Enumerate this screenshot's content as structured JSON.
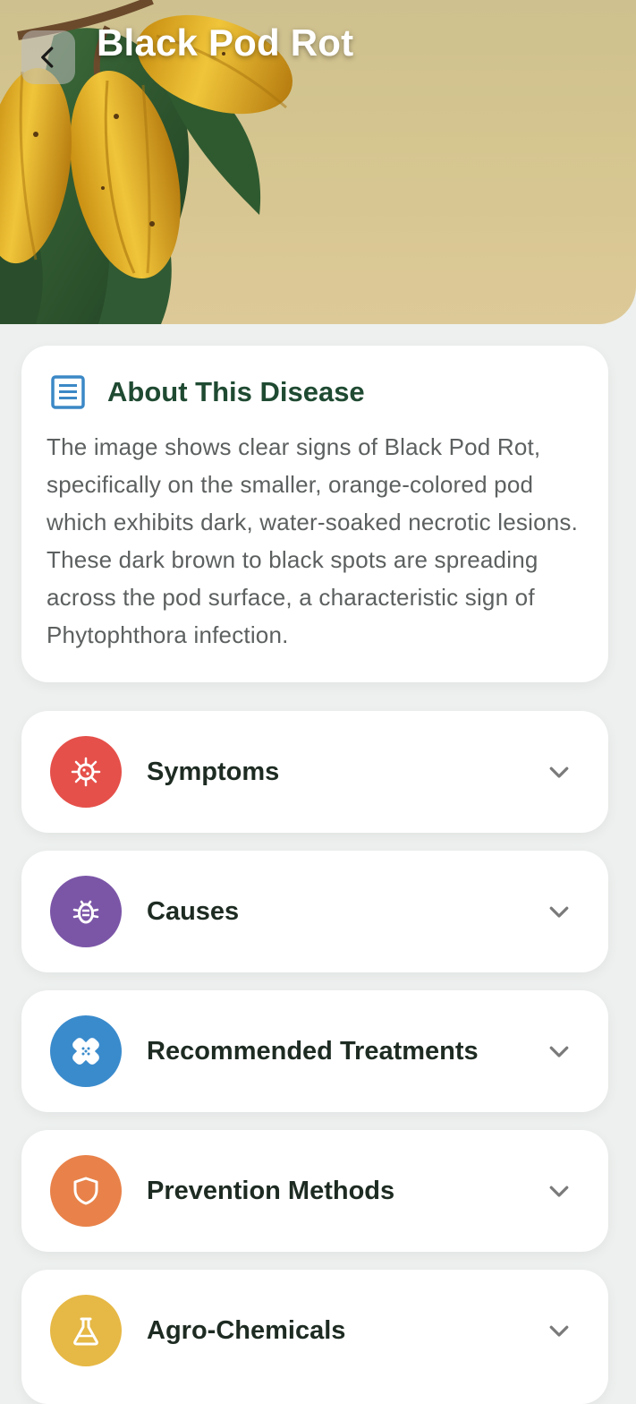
{
  "header": {
    "title": "Black Pod Rot",
    "back_icon": "chevron-left-icon"
  },
  "about": {
    "icon": "document-icon",
    "title": "About This Disease",
    "text": "The image shows clear signs of Black Pod Rot, specifically on the smaller, orange-colored pod which exhibits dark, water-soaked necrotic lesions. These dark brown to black spots are spreading across the pod surface, a characteristic sign of Phytophthora infection."
  },
  "sections": [
    {
      "label": "Symptoms",
      "icon": "virus-icon",
      "color": "#e5504a"
    },
    {
      "label": "Causes",
      "icon": "bug-icon",
      "color": "#7b56a7"
    },
    {
      "label": "Recommended Treatments",
      "icon": "bandage-icon",
      "color": "#3a8bcc"
    },
    {
      "label": "Prevention Methods",
      "icon": "shield-icon",
      "color": "#e8824a"
    },
    {
      "label": "Agro-Chemicals",
      "icon": "flask-icon",
      "color": "#e6b845"
    }
  ]
}
